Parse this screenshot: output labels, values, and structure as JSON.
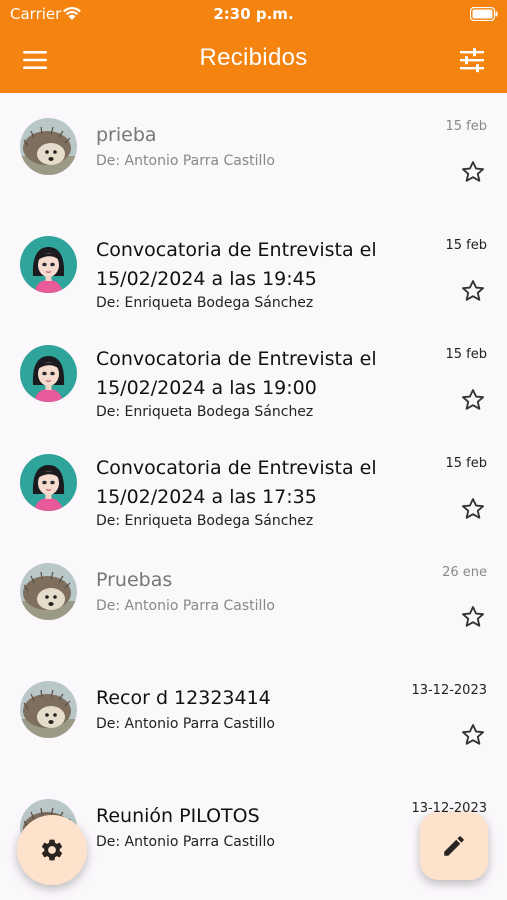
{
  "status_bar": {
    "carrier": "Carrier",
    "time": "2:30 p.m."
  },
  "app_bar": {
    "title": "Recibidos",
    "menu_icon": "hamburger-menu-icon",
    "filter_icon": "tune-filter-icon"
  },
  "messages": [
    {
      "subject_line1": "prieba",
      "subject_line2": "",
      "sender": "De: Antonio Parra Castillo",
      "date": "15 feb",
      "read": true,
      "avatar": "hedgehog-avatar",
      "starred": false
    },
    {
      "subject_line1": "Convocatoria de Entrevista el",
      "subject_line2": "15/02/2024 a las 19:45",
      "sender": "De: Enriqueta Bodega Sánchez",
      "date": "15 feb",
      "read": false,
      "avatar": "woman-avatar",
      "starred": false
    },
    {
      "subject_line1": "Convocatoria de Entrevista el",
      "subject_line2": "15/02/2024 a las 19:00",
      "sender": "De: Enriqueta Bodega Sánchez",
      "date": "15 feb",
      "read": false,
      "avatar": "woman-avatar",
      "starred": false
    },
    {
      "subject_line1": "Convocatoria de Entrevista el",
      "subject_line2": "15/02/2024 a las 17:35",
      "sender": "De: Enriqueta Bodega Sánchez",
      "date": "15 feb",
      "read": false,
      "avatar": "woman-avatar",
      "starred": false
    },
    {
      "subject_line1": "Pruebas",
      "subject_line2": "",
      "sender": "De: Antonio Parra Castillo",
      "date": "26 ene",
      "read": true,
      "avatar": "hedgehog-avatar",
      "starred": false
    },
    {
      "subject_line1": "Recor d 12323414",
      "subject_line2": "",
      "sender": "De: Antonio Parra Castillo",
      "date": "13-12-2023",
      "read": false,
      "avatar": "hedgehog-avatar",
      "starred": false
    },
    {
      "subject_line1": "Reunión PILOTOS",
      "subject_line2": "",
      "sender": "De: Antonio Parra Castillo",
      "date": "13-12-2023",
      "read": false,
      "avatar": "hedgehog-avatar",
      "starred": false
    }
  ],
  "fabs": {
    "settings_icon": "gear-icon",
    "compose_icon": "pencil-icon"
  },
  "colors": {
    "accent": "#f4830f",
    "fab_bg": "#fde3cb",
    "background": "#fbf8fc"
  }
}
